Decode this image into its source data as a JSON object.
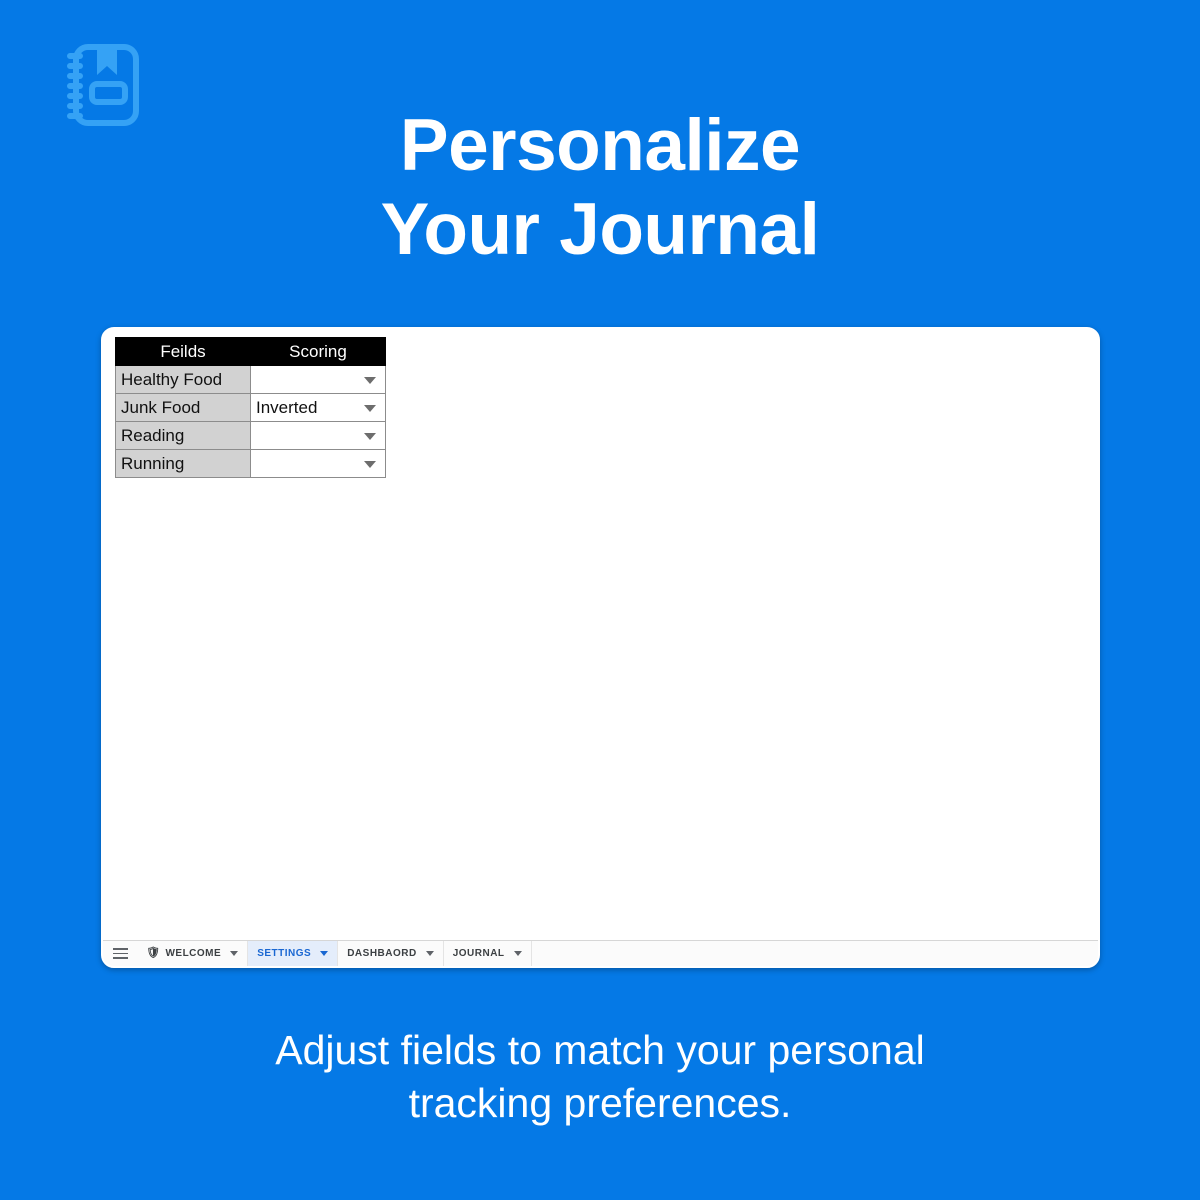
{
  "theme": {
    "background": "#0579e6",
    "logo_color": "#35a2f5",
    "accent_tab": "#1967d2",
    "active_tab_bg": "#e4edfb"
  },
  "logo": {
    "name": "journal-notebook-icon"
  },
  "headline": {
    "line1": "Personalize",
    "line2": "Your Journal"
  },
  "caption": {
    "line1": "Adjust fields to match your personal",
    "line2": "tracking preferences."
  },
  "spreadsheet": {
    "headers": [
      "Feilds",
      "Scoring"
    ],
    "rows": [
      {
        "field": "Healthy Food",
        "scoring": ""
      },
      {
        "field": "Junk Food",
        "scoring": "Inverted"
      },
      {
        "field": "Reading",
        "scoring": ""
      },
      {
        "field": "Running",
        "scoring": ""
      }
    ]
  },
  "tabbar": {
    "menu_icon": "hamburger-menu-icon",
    "tabs": [
      {
        "label": "WELCOME",
        "icon": "🛡",
        "active": false
      },
      {
        "label": "SETTINGS",
        "icon": "",
        "active": true
      },
      {
        "label": "DASHBAORD",
        "icon": "",
        "active": false
      },
      {
        "label": "JOURNAL",
        "icon": "",
        "active": false
      }
    ]
  }
}
